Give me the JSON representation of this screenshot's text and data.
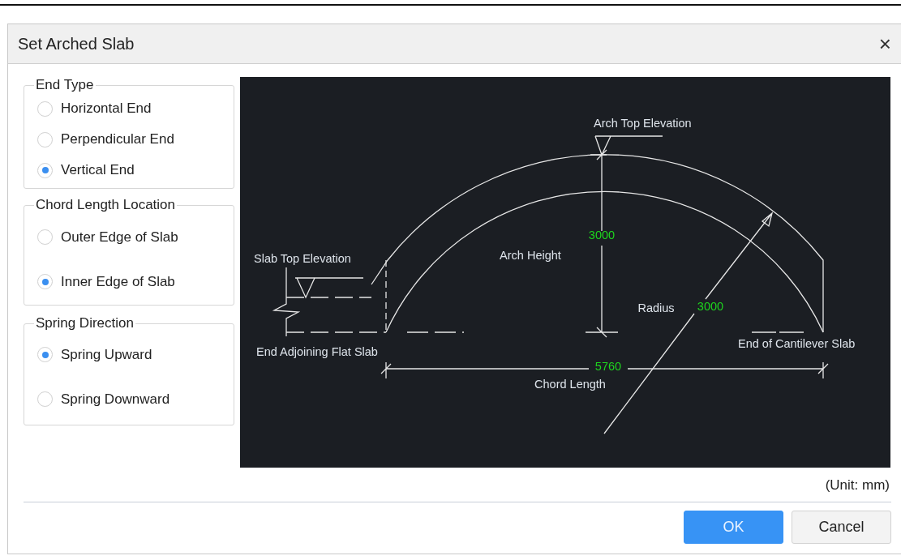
{
  "window": {
    "title": "Set Arched Slab",
    "close": "×"
  },
  "groups": [
    {
      "title": "End Type",
      "options": [
        {
          "label": "Horizontal End",
          "selected": false
        },
        {
          "label": "Perpendicular End",
          "selected": false
        },
        {
          "label": "Vertical End",
          "selected": true
        }
      ]
    },
    {
      "title": "Chord Length Location",
      "options": [
        {
          "label": "Outer Edge of Slab",
          "selected": false
        },
        {
          "label": "Inner Edge of Slab",
          "selected": true
        }
      ]
    },
    {
      "title": "Spring Direction",
      "options": [
        {
          "label": "Spring Upward",
          "selected": true
        },
        {
          "label": "Spring Downward",
          "selected": false
        }
      ]
    }
  ],
  "diagram": {
    "labels": [
      {
        "text": "Arch Top Elevation",
        "kind": "label"
      },
      {
        "text": "3000",
        "kind": "dimension"
      },
      {
        "text": "Slab Top Elevation",
        "kind": "label"
      },
      {
        "text": "Arch Height",
        "kind": "label"
      },
      {
        "text": "Radius",
        "kind": "label"
      },
      {
        "text": "3000",
        "kind": "dimension"
      },
      {
        "text": "End Adjoining Flat Slab",
        "kind": "label"
      },
      {
        "text": "End of Cantilever Slab",
        "kind": "label"
      },
      {
        "text": "5760",
        "kind": "dimension"
      },
      {
        "text": "Chord Length",
        "kind": "label"
      }
    ]
  },
  "unit_note": "(Unit: mm)",
  "buttons": [
    {
      "label": "OK",
      "kind": "primary"
    },
    {
      "label": "Cancel",
      "kind": "secondary"
    }
  ]
}
